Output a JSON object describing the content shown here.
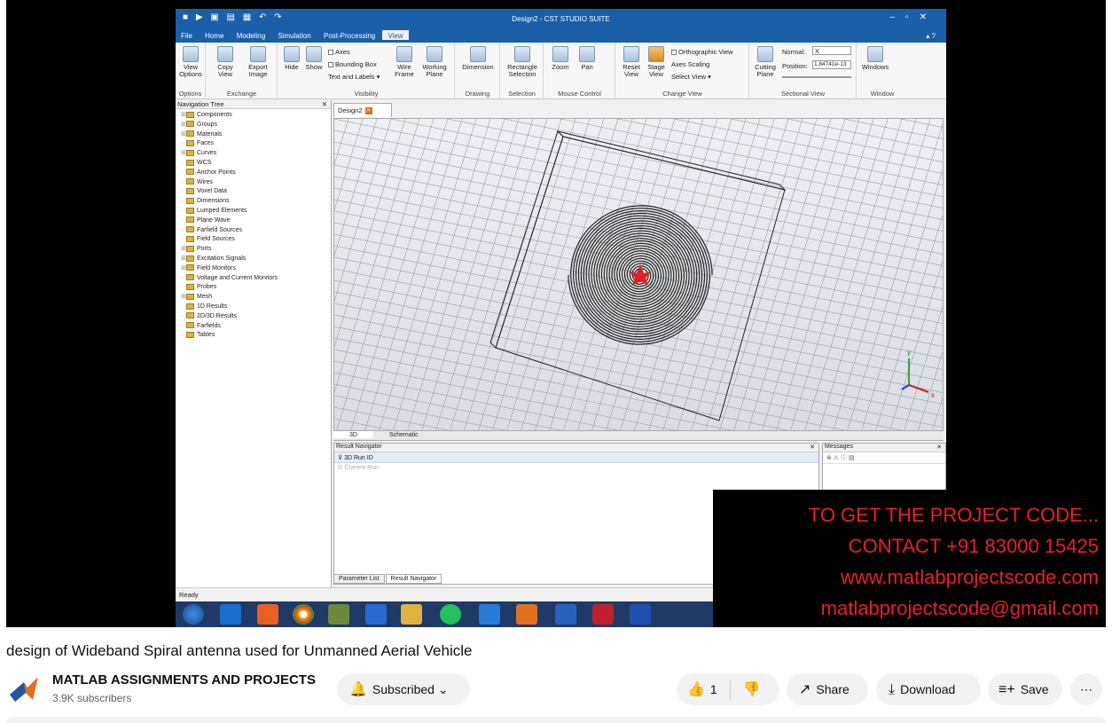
{
  "app": {
    "title": "Design2 - CST STUDIO SUITE",
    "menu": [
      "File",
      "Home",
      "Modeling",
      "Simulation",
      "Post-Processing",
      "View"
    ],
    "active_menu": "View"
  },
  "ribbon": {
    "groups": [
      {
        "label": "Options",
        "buttons": [
          "View Options"
        ]
      },
      {
        "label": "Exchange",
        "buttons": [
          "Copy View",
          "Export Image"
        ]
      },
      {
        "label": "Visibility",
        "buttons": [
          "Hide",
          "Show",
          "Wire Frame",
          "Working Plane"
        ],
        "checks": [
          "Axes",
          "Bounding Box",
          "Text and Labels"
        ]
      },
      {
        "label": "Drawing",
        "buttons": [
          "Dimension"
        ]
      },
      {
        "label": "Selection",
        "buttons": [
          "Rectangle Selection"
        ]
      },
      {
        "label": "Mouse Control",
        "buttons": [
          "Zoom",
          "Pan"
        ]
      },
      {
        "label": "Change View",
        "buttons": [
          "Reset View",
          "Stage View"
        ],
        "checks": [
          "Orthographic View",
          "Axes Scaling",
          "Select View"
        ]
      },
      {
        "label": "Sectional View",
        "buttons": [
          "Cutting Plane"
        ],
        "normal_label": "Normal:",
        "normal_value": "X",
        "position_label": "Position:",
        "position_value": "1.84741e-13"
      },
      {
        "label": "Window",
        "buttons": [
          "Windows"
        ]
      }
    ]
  },
  "navtree": {
    "title": "Navigation Tree",
    "items": [
      "Components",
      "Groups",
      "Materials",
      "Faces",
      "Curves",
      "WCS",
      "Anchor Points",
      "Wires",
      "Voxel Data",
      "Dimensions",
      "Lumped Elements",
      "Plane Wave",
      "Farfield Sources",
      "Field Sources",
      "Ports",
      "Excitation Signals",
      "Field Monitors",
      "Voltage and Current Monitors",
      "Probes",
      "Mesh",
      "1D Results",
      "2D/3D Results",
      "Farfields",
      "Tables"
    ],
    "expandable": [
      true,
      true,
      true,
      false,
      true,
      false,
      false,
      false,
      false,
      false,
      false,
      false,
      false,
      false,
      true,
      true,
      true,
      false,
      false,
      true,
      false,
      false,
      false,
      false
    ]
  },
  "document_tab": "Design2",
  "view_tabs": [
    "3D",
    "Schematic"
  ],
  "result_navigator": {
    "title": "Result Navigator",
    "rows": [
      "3D Run ID",
      "0: Current Run"
    ]
  },
  "messages": {
    "title": "Messages"
  },
  "bottom_tabs": [
    "Parameter List",
    "Result Navigator"
  ],
  "status": "Ready",
  "axes": {
    "y": "y",
    "x": "x"
  },
  "promo_lines": [
    "TO GET THE PROJECT CODE...",
    "CONTACT +91 83000 15425",
    "www.matlabprojectscode.com",
    "matlabprojectscode@gmail.com"
  ],
  "video": {
    "title": "design of Wideband Spiral antenna used for Unmanned Aerial Vehicle",
    "channel": "MATLAB ASSIGNMENTS AND PROJECTS",
    "subscribers": "3.9K subscribers",
    "subscribe_label": "Subscribed",
    "likes": "1",
    "share_label": "Share",
    "download_label": "Download",
    "save_label": "Save"
  },
  "colors": {
    "cst_blue": "#1a5fa8",
    "promo_red": "#e8202a",
    "spiral": "#222222"
  }
}
